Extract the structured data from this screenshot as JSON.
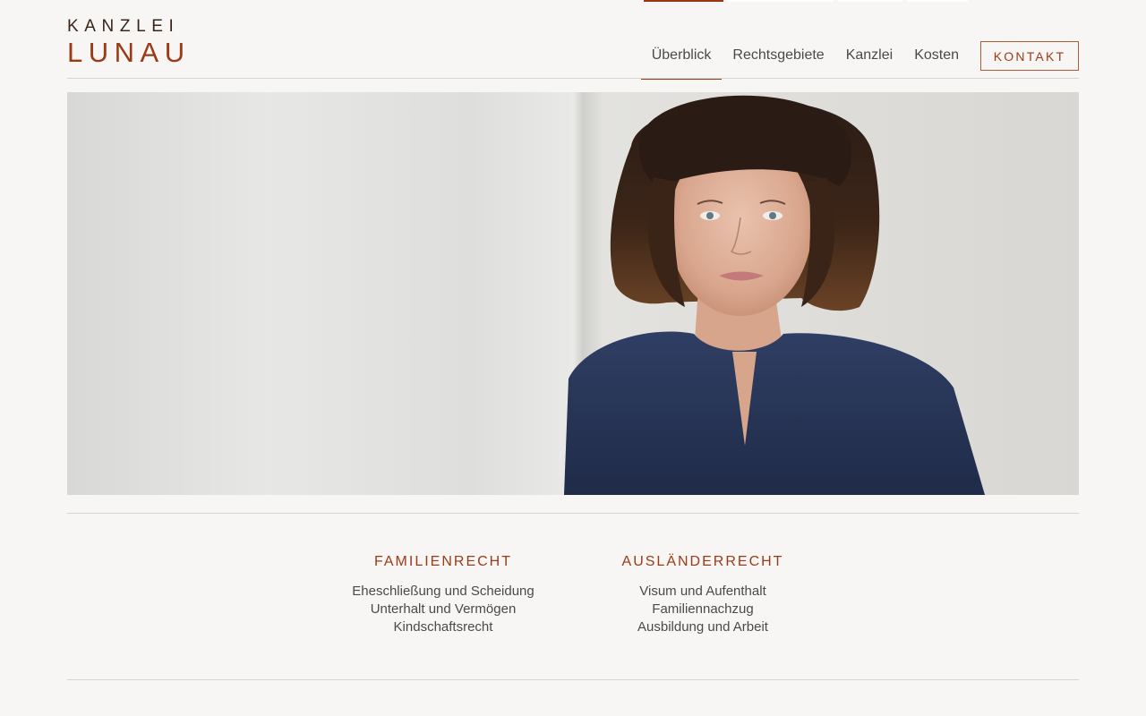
{
  "logo": {
    "line1": "KANZLEI",
    "line2": "LUNAU"
  },
  "nav": {
    "items": [
      {
        "label": "Überblick",
        "active": true
      },
      {
        "label": "Rechtsgebiete",
        "active": false
      },
      {
        "label": "Kanzlei",
        "active": false
      },
      {
        "label": "Kosten",
        "active": false
      }
    ],
    "contact_label": "KONTAKT"
  },
  "areas": [
    {
      "title": "FAMILIENRECHT",
      "items": [
        "Eheschließung und Scheidung",
        "Unterhalt und Vermögen",
        "Kindschaftsrecht"
      ]
    },
    {
      "title": "AUSLÄNDERRECHT",
      "items": [
        "Visum und Aufenthalt",
        "Familiennachzug",
        "Ausbildung und Arbeit"
      ]
    }
  ],
  "colors": {
    "accent": "#9a3b16",
    "background": "#f7f6f4",
    "text": "#4a4a4a"
  },
  "icons": {
    "hero": "portrait-photo"
  }
}
